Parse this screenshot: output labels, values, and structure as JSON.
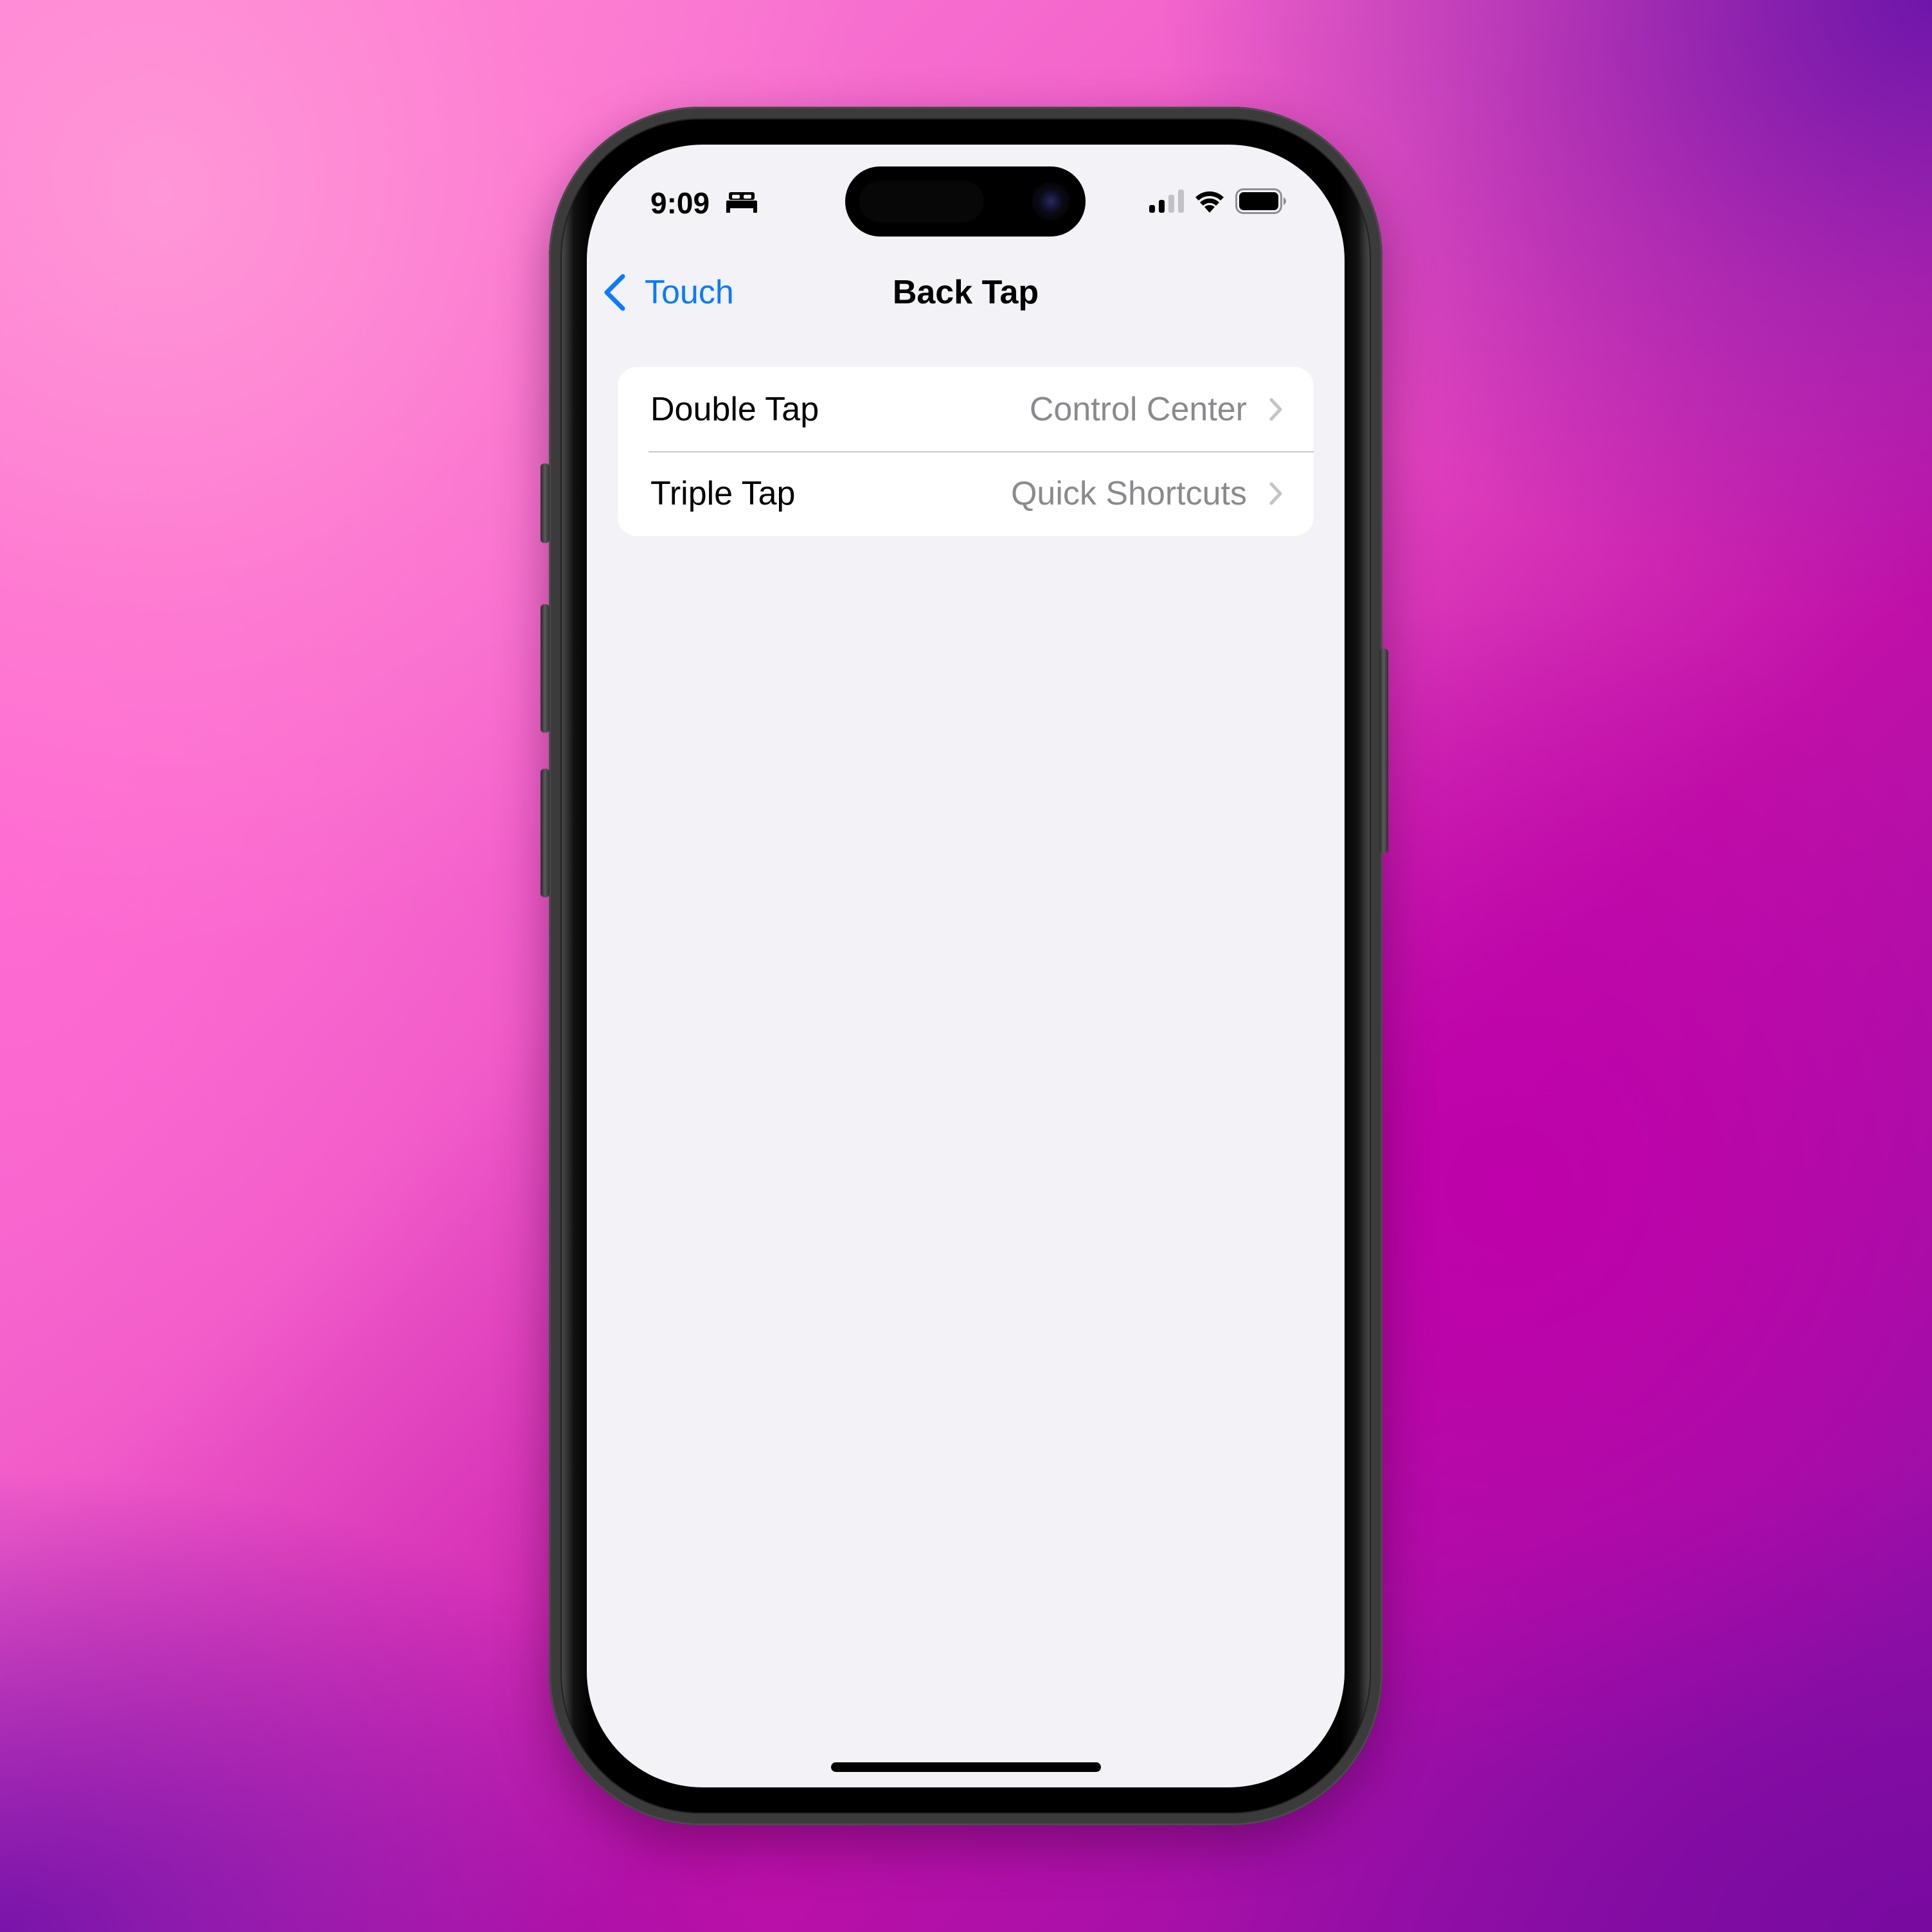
{
  "status_bar": {
    "time": "9:09",
    "focus_icon": "bed-icon",
    "signal_bars_filled": 2,
    "signal_bars_total": 4,
    "wifi_icon": "wifi-icon",
    "battery_level_percent": 100
  },
  "nav": {
    "back_label": "Touch",
    "back_icon": "chevron-left-icon",
    "title": "Back Tap"
  },
  "settings": {
    "rows": [
      {
        "label": "Double Tap",
        "value": "Control Center",
        "icon": "chevron-right-icon"
      },
      {
        "label": "Triple Tap",
        "value": "Quick Shortcuts",
        "icon": "chevron-right-icon"
      }
    ]
  },
  "colors": {
    "accent": "#0a7aff",
    "background": "#f2f2f7",
    "card": "#ffffff",
    "secondary_text": "#8a8a8e",
    "chevron": "#c4c4c7",
    "separator": "#c8c8cc"
  }
}
